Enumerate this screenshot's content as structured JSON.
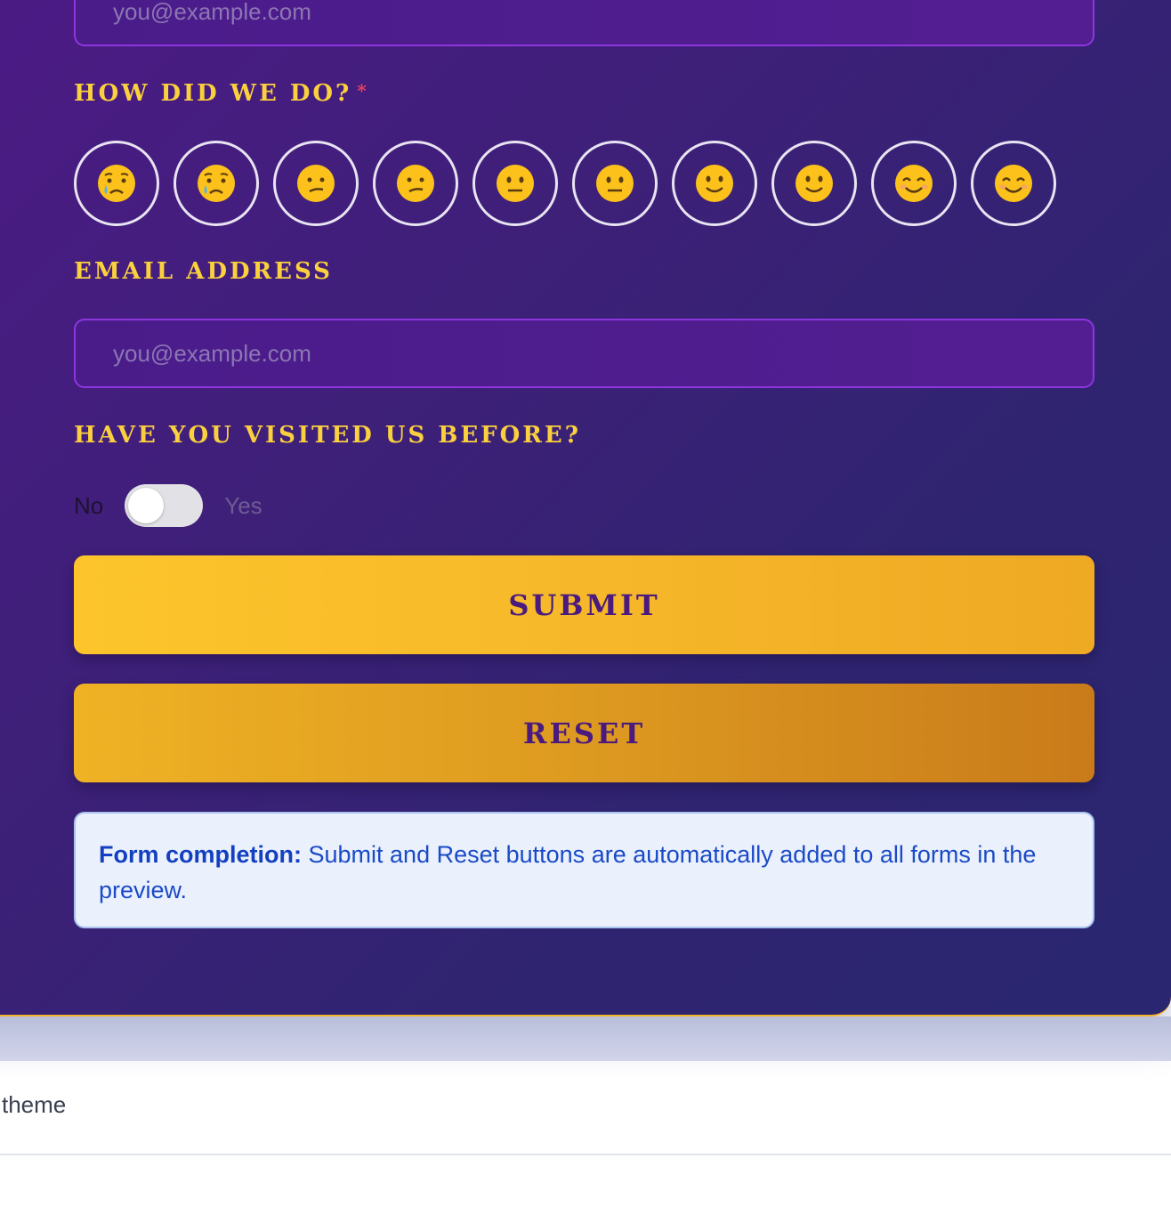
{
  "form": {
    "top_email_placeholder": "you@example.com",
    "rating": {
      "label": "HOW DID WE DO?",
      "required_mark": "*",
      "options": [
        {
          "icon": "crying-face-icon"
        },
        {
          "icon": "crying-face-icon"
        },
        {
          "icon": "confused-face-icon"
        },
        {
          "icon": "confused-face-icon"
        },
        {
          "icon": "neutral-face-icon"
        },
        {
          "icon": "neutral-face-icon"
        },
        {
          "icon": "slightly-smiling-face-icon"
        },
        {
          "icon": "slightly-smiling-face-icon"
        },
        {
          "icon": "smiling-face-icon"
        },
        {
          "icon": "smiling-face-icon"
        }
      ]
    },
    "email": {
      "label": "EMAIL ADDRESS",
      "placeholder": "you@example.com"
    },
    "visited": {
      "label": "HAVE YOU VISITED US BEFORE?",
      "off_label": "No",
      "on_label": "Yes",
      "value": false
    },
    "submit_label": "SUBMIT",
    "reset_label": "RESET",
    "info": {
      "title": "Form completion:",
      "text": " Submit and Reset buttons are automatically added to all forms in the preview."
    }
  },
  "footer": {
    "text": "theme"
  },
  "colors": {
    "accent_gold": "#fbd03e",
    "card_purple": "#3d2078",
    "info_blue": "#1b4ac7"
  }
}
